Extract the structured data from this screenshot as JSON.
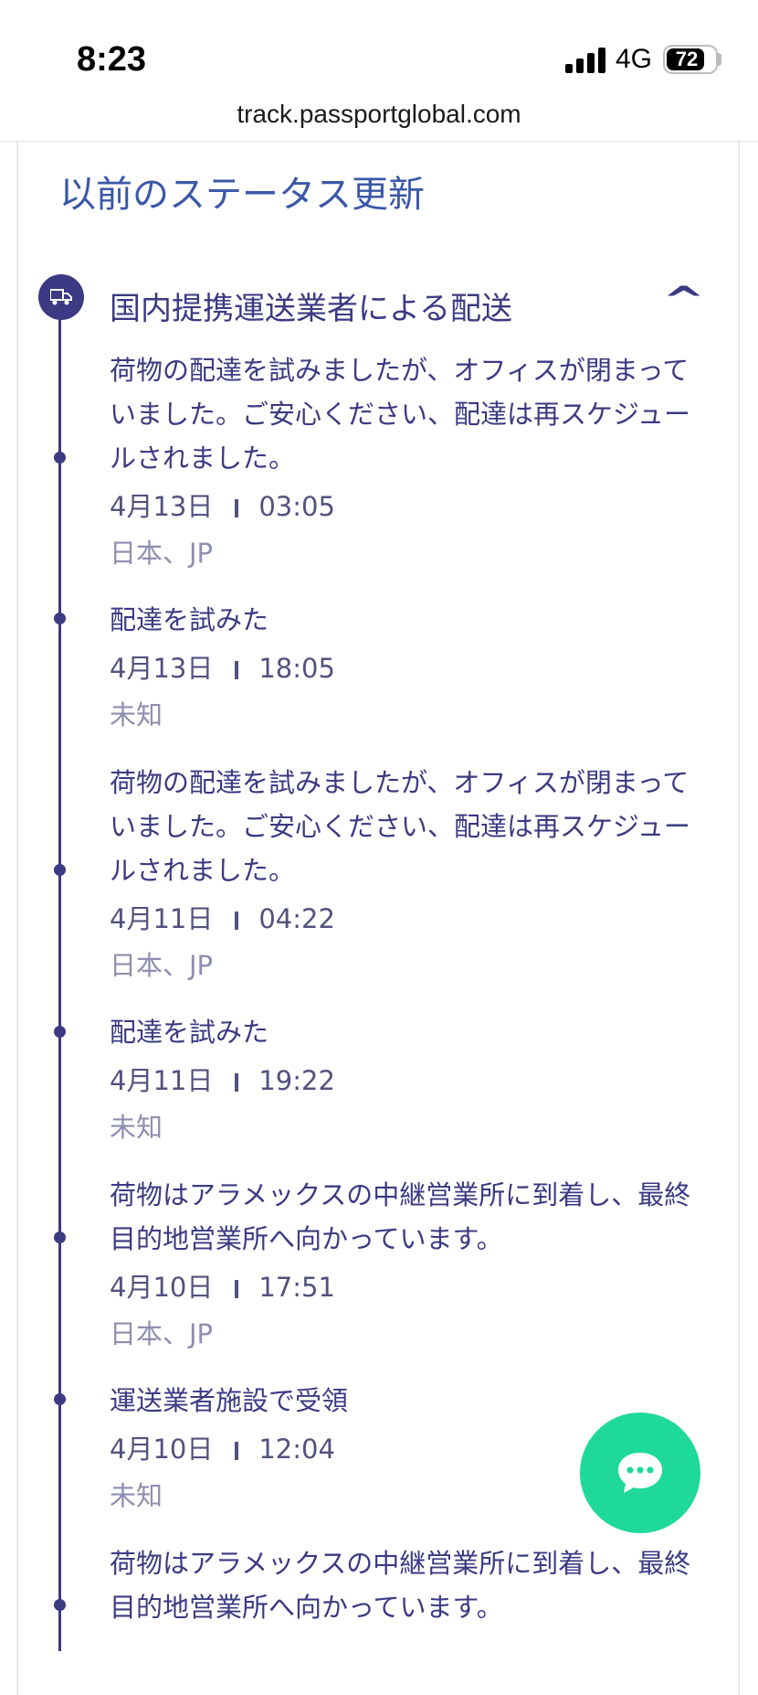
{
  "status_bar": {
    "time": "8:23",
    "network": "4G",
    "battery": "72"
  },
  "browser": {
    "url": "track.passportglobal.com"
  },
  "section_title": "以前のステータス更新",
  "group": {
    "title": "国内提携運送業者による配送",
    "icon": "truck-icon",
    "chevron": "^"
  },
  "events": [
    {
      "description": "荷物の配達を試みましたが、オフィスが閉まっていました。ご安心ください、配達は再スケジュールされました。",
      "date": "4月13日",
      "time": "03:05",
      "location": "日本、JP"
    },
    {
      "description": "配達を試みた",
      "date": "4月13日",
      "time": "18:05",
      "location": "未知"
    },
    {
      "description": "荷物の配達を試みましたが、オフィスが閉まっていました。ご安心ください、配達は再スケジュールされました。",
      "date": "4月11日",
      "time": "04:22",
      "location": "日本、JP"
    },
    {
      "description": "配達を試みた",
      "date": "4月11日",
      "time": "19:22",
      "location": "未知"
    },
    {
      "description": "荷物はアラメックスの中継営業所に到着し、最終目的地営業所へ向かっています。",
      "date": "4月10日",
      "time": "17:51",
      "location": "日本、JP"
    },
    {
      "description": "運送業者施設で受領",
      "date": "4月10日",
      "time": "12:04",
      "location": "未知"
    },
    {
      "description": "荷物はアラメックスの中継営業所に到着し、最終目的地営業所へ向かっています。",
      "date": "",
      "time": "",
      "location": ""
    }
  ],
  "colors": {
    "primary": "#3b3a82",
    "title": "#3b58a8",
    "muted": "#8e8eb0",
    "chat": "#1fd99a"
  }
}
